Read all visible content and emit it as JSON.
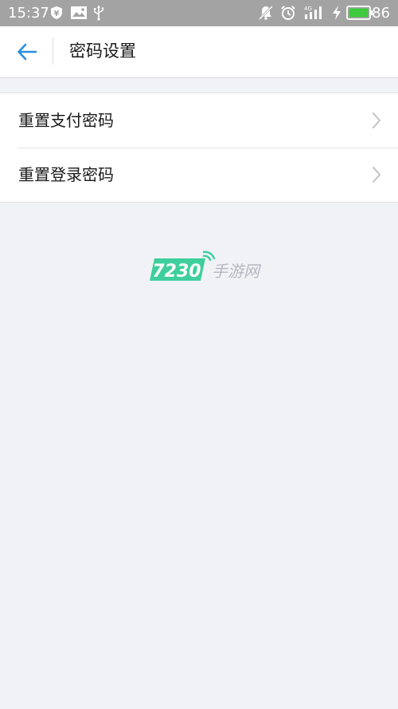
{
  "status_bar": {
    "time": "15:37",
    "battery_percent": "86",
    "network": "4G",
    "icons": [
      "shield-yen-icon",
      "image-icon",
      "usb-icon",
      "mute-icon",
      "alarm-icon",
      "signal-icon",
      "charging-icon",
      "battery-icon"
    ]
  },
  "header": {
    "back_icon": "arrow-left-icon",
    "title": "密码设置"
  },
  "menu": {
    "items": [
      {
        "label": "重置支付密码",
        "icon": "chevron-right-icon"
      },
      {
        "label": "重置登录密码",
        "icon": "chevron-right-icon"
      }
    ]
  },
  "watermark": {
    "number": "7230",
    "text": "手游网"
  },
  "colors": {
    "status_bar": "#a3a3a3",
    "accent": "#2a8fe0",
    "background": "#f1f2f6",
    "battery": "#3ec93e",
    "watermark_green": "#3ecf9c"
  }
}
